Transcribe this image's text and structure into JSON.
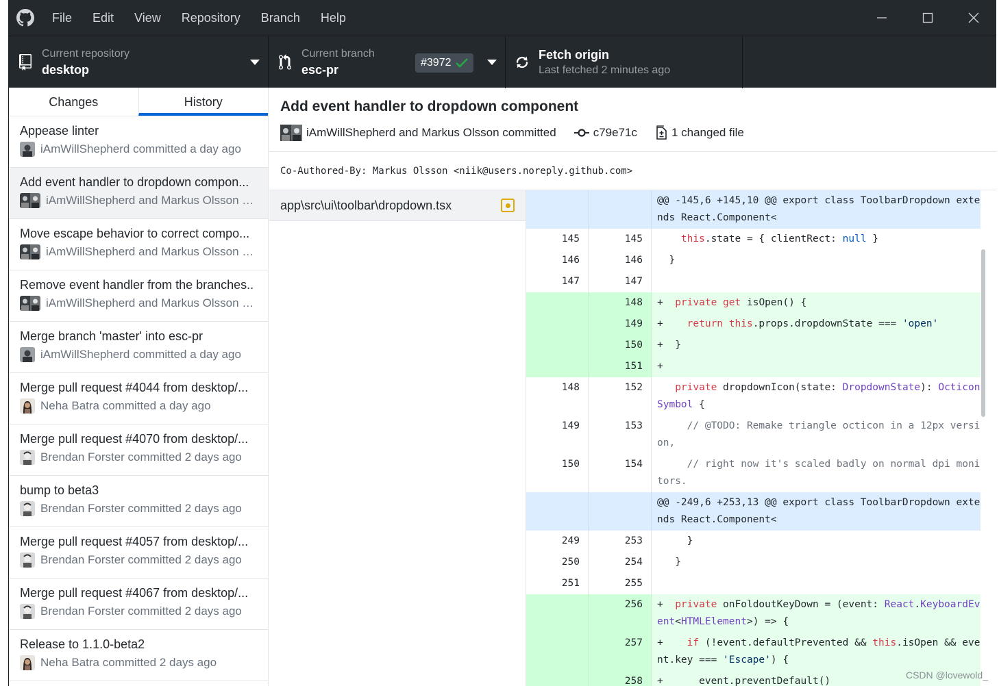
{
  "menu": [
    "File",
    "Edit",
    "View",
    "Repository",
    "Branch",
    "Help"
  ],
  "toolbar": {
    "repo_label": "Current repository",
    "repo_value": "desktop",
    "branch_label": "Current branch",
    "branch_value": "esc-pr",
    "pr_number": "#3972",
    "fetch_title": "Fetch origin",
    "fetch_sub": "Last fetched 2 minutes ago"
  },
  "sidebar": {
    "tabs": [
      "Changes",
      "History"
    ],
    "active_tab": "History",
    "commits": [
      {
        "title": "Appease linter",
        "meta": "iAmWillShepherd committed a day ago",
        "avatar": "single-dark"
      },
      {
        "title": "Add event handler to dropdown compon...",
        "meta": "iAmWillShepherd and Markus Olsson co...",
        "avatar": "pair"
      },
      {
        "title": "Move escape behavior to correct compo...",
        "meta": "iAmWillShepherd and Markus Olsson co...",
        "avatar": "pair"
      },
      {
        "title": "Remove event handler from the branches..",
        "meta": "iAmWillShepherd and Markus Olsson co...",
        "avatar": "pair"
      },
      {
        "title": "Merge branch 'master' into esc-pr",
        "meta": "iAmWillShepherd committed a day ago",
        "avatar": "single-dark"
      },
      {
        "title": "Merge pull request #4044 from desktop/...",
        "meta": "Neha Batra committed a day ago",
        "avatar": "neha"
      },
      {
        "title": "Merge pull request #4070 from desktop/...",
        "meta": "Brendan Forster committed 2 days ago",
        "avatar": "brendan"
      },
      {
        "title": "bump to beta3",
        "meta": "Brendan Forster committed 2 days ago",
        "avatar": "brendan"
      },
      {
        "title": "Merge pull request #4057 from desktop/...",
        "meta": "Brendan Forster committed 2 days ago",
        "avatar": "brendan"
      },
      {
        "title": "Merge pull request #4067 from desktop/...",
        "meta": "Brendan Forster committed 2 days ago",
        "avatar": "brendan"
      },
      {
        "title": "Release to 1.1.0-beta2",
        "meta": "Neha Batra committed 2 days ago",
        "avatar": "neha"
      }
    ]
  },
  "detail": {
    "title": "Add event handler to dropdown component",
    "authors": "iAmWillShepherd and Markus Olsson committed",
    "sha": "c79e71c",
    "changed": "1 changed file",
    "coauthor": "Co-Authored-By: Markus Olsson <niik@users.noreply.github.com>"
  },
  "files": [
    {
      "path": "app\\src\\ui\\toolbar\\dropdown.tsx",
      "status": "modified"
    }
  ],
  "diff": [
    {
      "type": "hunk",
      "old": "",
      "new": "",
      "text": "@@ -145,6 +145,10 @@ export class ToolbarDropdown extends React.Component<"
    },
    {
      "type": "ctx",
      "old": "145",
      "new": "145",
      "text": "    this.state = { clientRect: null }"
    },
    {
      "type": "ctx",
      "old": "146",
      "new": "146",
      "text": "  }"
    },
    {
      "type": "ctx",
      "old": "147",
      "new": "147",
      "text": ""
    },
    {
      "type": "add",
      "old": "",
      "new": "148",
      "text": "+  private get isOpen() {"
    },
    {
      "type": "add",
      "old": "",
      "new": "149",
      "text": "+    return this.props.dropdownState === 'open'"
    },
    {
      "type": "add",
      "old": "",
      "new": "150",
      "text": "+  }"
    },
    {
      "type": "add",
      "old": "",
      "new": "151",
      "text": "+"
    },
    {
      "type": "ctx",
      "old": "148",
      "new": "152",
      "text": "   private dropdownIcon(state: DropdownState): OcticonSymbol {"
    },
    {
      "type": "ctx",
      "old": "149",
      "new": "153",
      "text": "     // @TODO: Remake triangle octicon in a 12px version,"
    },
    {
      "type": "ctx",
      "old": "150",
      "new": "154",
      "text": "     // right now it's scaled badly on normal dpi monitors."
    },
    {
      "type": "hunk",
      "old": "",
      "new": "",
      "text": "@@ -249,6 +253,13 @@ export class ToolbarDropdown extends React.Component<"
    },
    {
      "type": "ctx",
      "old": "249",
      "new": "253",
      "text": "     }"
    },
    {
      "type": "ctx",
      "old": "250",
      "new": "254",
      "text": "   }"
    },
    {
      "type": "ctx",
      "old": "251",
      "new": "255",
      "text": ""
    },
    {
      "type": "add",
      "old": "",
      "new": "256",
      "text": "+  private onFoldoutKeyDown = (event: React.KeyboardEvent<HTMLElement>) => {"
    },
    {
      "type": "add",
      "old": "",
      "new": "257",
      "text": "+    if (!event.defaultPrevented && this.isOpen && event.key === 'Escape') {"
    },
    {
      "type": "add",
      "old": "",
      "new": "258",
      "text": "+      event.preventDefault()"
    }
  ],
  "colors": {
    "chrome": "#24292e",
    "accent": "#0366d6",
    "added_bg": "#e6ffed",
    "hunk_bg": "#dbedff",
    "modified": "#dbab09",
    "check": "#28a745"
  },
  "watermark": "CSDN @lovewold_"
}
